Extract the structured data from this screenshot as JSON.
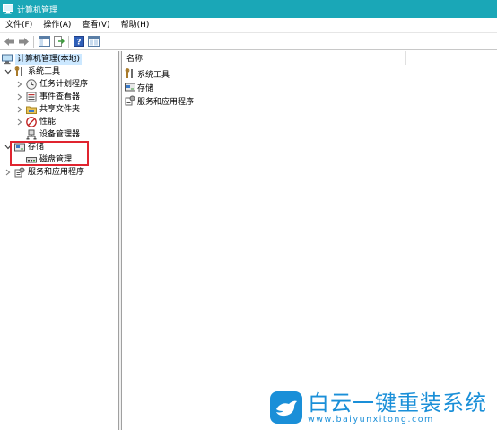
{
  "window": {
    "title": "计算机管理",
    "titlebar_color": "#1aa7b7"
  },
  "menu": {
    "items": [
      "文件(F)",
      "操作(A)",
      "查看(V)",
      "帮助(H)"
    ]
  },
  "toolbar": {
    "buttons": [
      "back-arrow-icon",
      "forward-arrow-icon",
      "show-hide-tree-icon",
      "export-list-icon",
      "help-icon",
      "properties-icon"
    ]
  },
  "tree": {
    "root": "计算机管理(本地)",
    "system_tools": "系统工具",
    "task_scheduler": "任务计划程序",
    "event_viewer": "事件查看器",
    "shared_folders": "共享文件夹",
    "performance": "性能",
    "device_manager": "设备管理器",
    "storage": "存储",
    "disk_management": "磁盘管理",
    "services_apps": "服务和应用程序"
  },
  "list": {
    "column_name": "名称",
    "rows": [
      "系统工具",
      "存储",
      "服务和应用程序"
    ]
  },
  "highlight": {
    "color": "#e0242f"
  },
  "watermark": {
    "main": "白云一键重装系统",
    "url": "www.baiyunxitong.com",
    "color": "#1a8fd8"
  }
}
